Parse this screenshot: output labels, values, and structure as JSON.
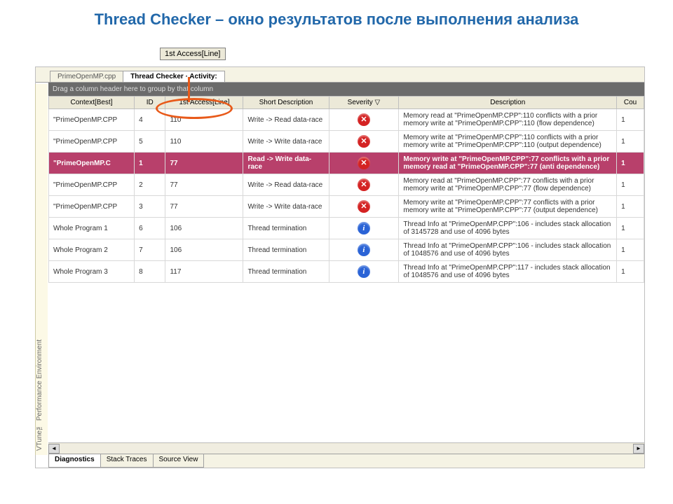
{
  "title": "Thread Checker – окно результатов после выполнения анализа",
  "callout": "1st Access[Line]",
  "sidebar_label": "VTune™ Performance Environment",
  "tabs_top": [
    {
      "label": "PrimeOpenMP.cpp",
      "active": false
    },
    {
      "label": "Thread Checker · Activity:",
      "active": true
    }
  ],
  "group_hint": "Drag a column header here to group by that column",
  "columns": {
    "context": "Context[Best]",
    "id": "ID",
    "access": "1st Access[Line]",
    "shortdesc": "Short Description",
    "severity": "Severity ▽",
    "desc": "Description",
    "count": "Cou"
  },
  "rows": [
    {
      "context": "\"PrimeOpenMP.CPP",
      "id": "4",
      "access": "110",
      "shortdesc": "Write -> Read data-race",
      "sev": "error",
      "desc": "Memory read at \"PrimeOpenMP.CPP\":110 conflicts with a prior memory write at \"PrimeOpenMP.CPP\":110 (flow dependence)",
      "count": "1",
      "selected": false
    },
    {
      "context": "\"PrimeOpenMP.CPP",
      "id": "5",
      "access": "110",
      "shortdesc": "Write -> Write data-race",
      "sev": "error",
      "desc": "Memory write at \"PrimeOpenMP.CPP\":110 conflicts with a prior memory write at \"PrimeOpenMP.CPP\":110 (output dependence)",
      "count": "1",
      "selected": false
    },
    {
      "context": "\"PrimeOpenMP.C",
      "id": "1",
      "access": "77",
      "shortdesc": "Read -> Write data-race",
      "sev": "error",
      "desc": "Memory write at \"PrimeOpenMP.CPP\":77 conflicts with a prior memory read at \"PrimeOpenMP.CPP\":77 (anti dependence)",
      "count": "1",
      "selected": true
    },
    {
      "context": "\"PrimeOpenMP.CPP",
      "id": "2",
      "access": "77",
      "shortdesc": "Write -> Read data-race",
      "sev": "error",
      "desc": "Memory read at \"PrimeOpenMP.CPP\":77 conflicts with a prior memory write at \"PrimeOpenMP.CPP\":77 (flow dependence)",
      "count": "1",
      "selected": false
    },
    {
      "context": "\"PrimeOpenMP.CPP",
      "id": "3",
      "access": "77",
      "shortdesc": "Write -> Write data-race",
      "sev": "error",
      "desc": "Memory write at \"PrimeOpenMP.CPP\":77 conflicts with a prior memory write at \"PrimeOpenMP.CPP\":77 (output dependence)",
      "count": "1",
      "selected": false
    },
    {
      "context": "Whole Program 1",
      "id": "6",
      "access": "106",
      "shortdesc": "Thread termination",
      "sev": "info",
      "desc": "Thread Info at \"PrimeOpenMP.CPP\":106 - includes stack allocation of 3145728 and use of 4096 bytes",
      "count": "1",
      "selected": false
    },
    {
      "context": "Whole Program 2",
      "id": "7",
      "access": "106",
      "shortdesc": "Thread termination",
      "sev": "info",
      "desc": "Thread Info at \"PrimeOpenMP.CPP\":106 - includes stack allocation of 1048576 and use of 4096 bytes",
      "count": "1",
      "selected": false
    },
    {
      "context": "Whole Program 3",
      "id": "8",
      "access": "117",
      "shortdesc": "Thread termination",
      "sev": "info",
      "desc": "Thread Info at \"PrimeOpenMP.CPP\":117 - includes stack allocation of 1048576 and use of 4096 bytes",
      "count": "1",
      "selected": false
    }
  ],
  "tabs_bottom": [
    {
      "label": "Diagnostics",
      "active": true
    },
    {
      "label": "Stack Traces",
      "active": false
    },
    {
      "label": "Source View",
      "active": false
    }
  ],
  "sev_glyph": {
    "error": "✕",
    "info": "i"
  }
}
